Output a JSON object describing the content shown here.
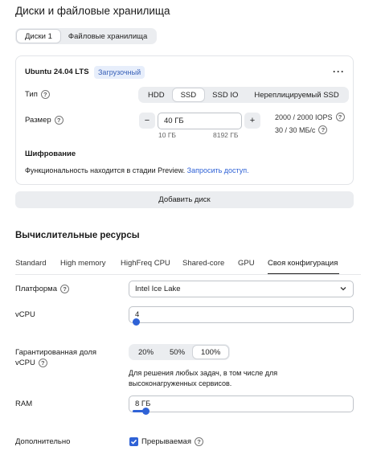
{
  "page": {
    "title": "Диски и файловые хранилища"
  },
  "storage_tabs": [
    {
      "label": "Диски 1",
      "active": true
    },
    {
      "label": "Файловые хранилища",
      "active": false
    }
  ],
  "disk": {
    "name": "Ubuntu 24.04 LTS",
    "badge": "Загрузочный",
    "more": "···",
    "type_label": "Тип",
    "types": [
      "HDD",
      "SSD",
      "SSD IO",
      "Нереплицируемый SSD"
    ],
    "selected_type": "SSD",
    "size_label": "Размер",
    "size_value": "40 ГБ",
    "size_min": "10 ГБ",
    "size_max": "8192 ГБ",
    "minus": "−",
    "plus": "+",
    "iops": "2000 / 2000 IOPS",
    "throughput": "30 / 30 МБ/с",
    "encryption_title": "Шифрование",
    "encryption_text": "Функциональность находится в стадии Preview.",
    "encryption_link": "Запросить доступ."
  },
  "add_disk_label": "Добавить диск",
  "compute": {
    "title": "Вычислительные ресурсы",
    "tabs": [
      "Standard",
      "High memory",
      "HighFreq CPU",
      "Shared-core",
      "GPU",
      "Своя конфигурация"
    ],
    "active_tab": "Своя конфигурация",
    "platform_label": "Платформа",
    "platform_value": "Intel Ice Lake",
    "vcpu_label": "vCPU",
    "vcpu_value": "4",
    "guaranteed_label_line1": "Гарантированная доля",
    "guaranteed_label_line2": "vCPU",
    "guaranteed_options": [
      "20%",
      "50%",
      "100%"
    ],
    "guaranteed_selected": "100%",
    "guaranteed_desc": "Для решения любых задач, в том числе для высоконагруженных сервисов.",
    "ram_label": "RAM",
    "ram_value": "8 ГБ",
    "extra_label": "Дополнительно",
    "preemptible_label": "Прерываемая",
    "preemptible_checked": true
  },
  "colors": {
    "accent": "#2f62d6",
    "badge_bg": "#e7eefb",
    "segment_bg": "#ebedf0"
  }
}
